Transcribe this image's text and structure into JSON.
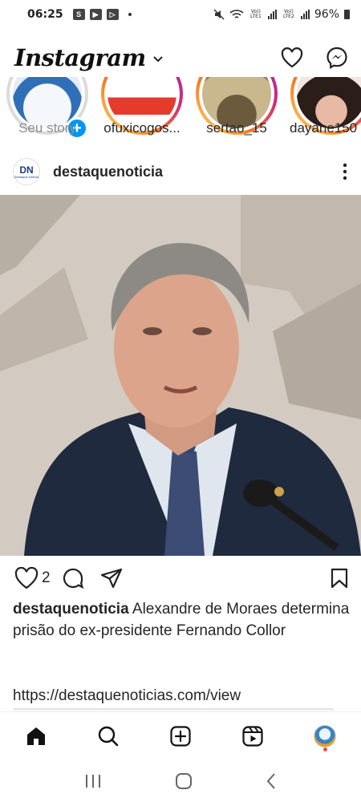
{
  "status_bar": {
    "time": "06:25",
    "app_icons": [
      "S",
      "youtube-icon",
      "play-store-icon"
    ],
    "sim1": "Vo)) LTE1",
    "sim2": "Vo)) LTE2",
    "battery": "96%"
  },
  "header": {
    "logo": "Instagram",
    "icons": [
      "chevron-down-icon",
      "heart-icon",
      "messenger-icon"
    ]
  },
  "stories": [
    {
      "label": "Seu story",
      "own": true
    },
    {
      "label": "ofuxicogos..."
    },
    {
      "label": "sertao_15"
    },
    {
      "label": "dayane150"
    }
  ],
  "post": {
    "username": "destaquenoticia",
    "avatar_text": "DN",
    "avatar_subtext": "Destaque Notícia",
    "like_count": "2",
    "caption_username": "destaquenoticia",
    "caption_text": "Alexandre de Moraes determina prisão do ex-presidente Fernando Collor",
    "caption_link": "https://destaquenoticias.com/view"
  },
  "bottom_nav": [
    "home-icon",
    "search-icon",
    "create-icon",
    "reels-icon",
    "profile-avatar"
  ],
  "colors": {
    "accent_blue": "#0095f6",
    "story_gradient": [
      "#feda75",
      "#fa7e1e",
      "#d62976",
      "#962fbf"
    ],
    "notification": "#ed4956"
  }
}
